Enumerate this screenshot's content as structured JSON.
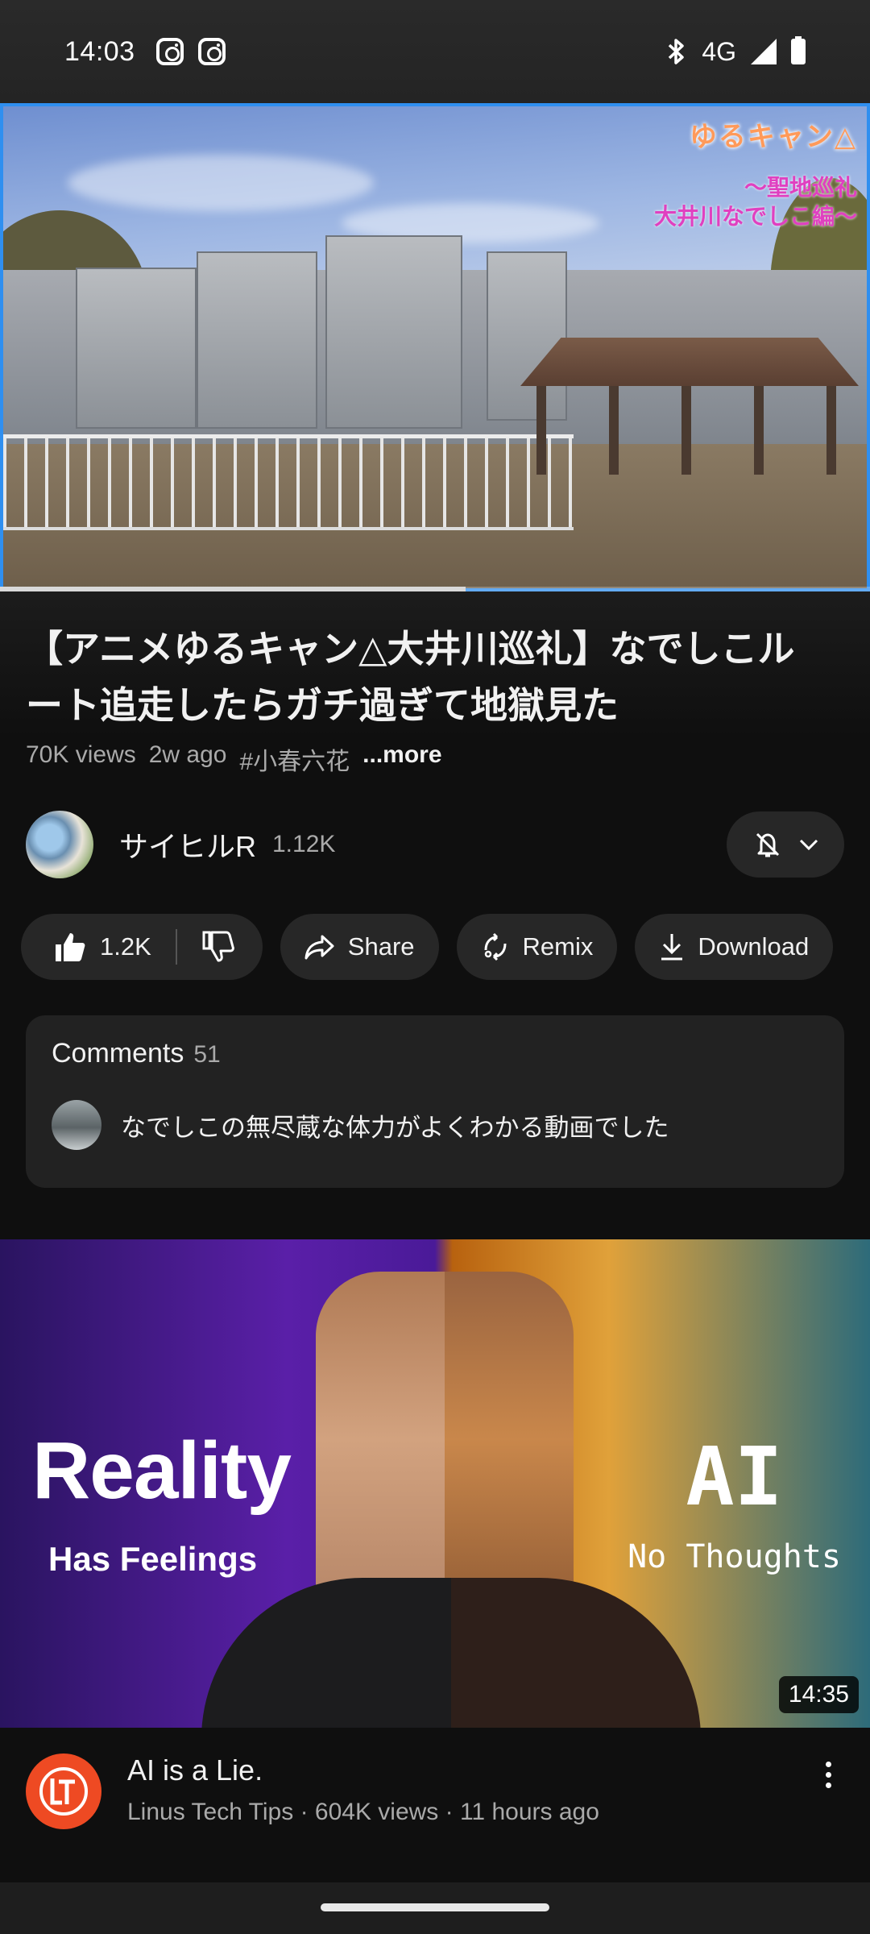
{
  "status_bar": {
    "time": "14:03",
    "network": "4G",
    "left_icons": [
      "instagram-icon",
      "instagram-icon"
    ],
    "right_icons": [
      "bluetooth-icon",
      "signal-icon",
      "battery-icon"
    ]
  },
  "player": {
    "overlay_logo": "ゆるキャン△",
    "overlay_subtitle_line1": "〜聖地巡礼",
    "overlay_subtitle_line2": "大井川なでしこ編〜",
    "progress_fraction": 0.535
  },
  "video": {
    "title": "【アニメゆるキャン△大井川巡礼】なでしこルート追走したらガチ過ぎて地獄見た",
    "views": "70K views",
    "age": "2w ago",
    "hashtag": "#小春六花",
    "more_label": "...more"
  },
  "channel": {
    "name": "サイヒルR",
    "subscribers": "1.12K"
  },
  "actions": {
    "like_count": "1.2K",
    "share_label": "Share",
    "remix_label": "Remix",
    "download_label": "Download"
  },
  "comments": {
    "heading": "Comments",
    "count": "51",
    "top_comment": "なでしこの無尽蔵な体力がよくわかる動画でした"
  },
  "next_video": {
    "thumb_left_big": "Reality",
    "thumb_left_small": "Has Feelings",
    "thumb_right_big": "AI",
    "thumb_right_small": "No Thoughts",
    "duration": "14:35",
    "title": "AI is a Lie.",
    "meta": "Linus Tech Tips · 604K views · 11 hours ago"
  },
  "colors": {
    "background": "#0f0f0f",
    "pill_bg": "#272727",
    "accent_player_border": "#2f8ff0",
    "secondary_text": "#aaaaaa",
    "ltt_orange": "#ee4a23"
  }
}
